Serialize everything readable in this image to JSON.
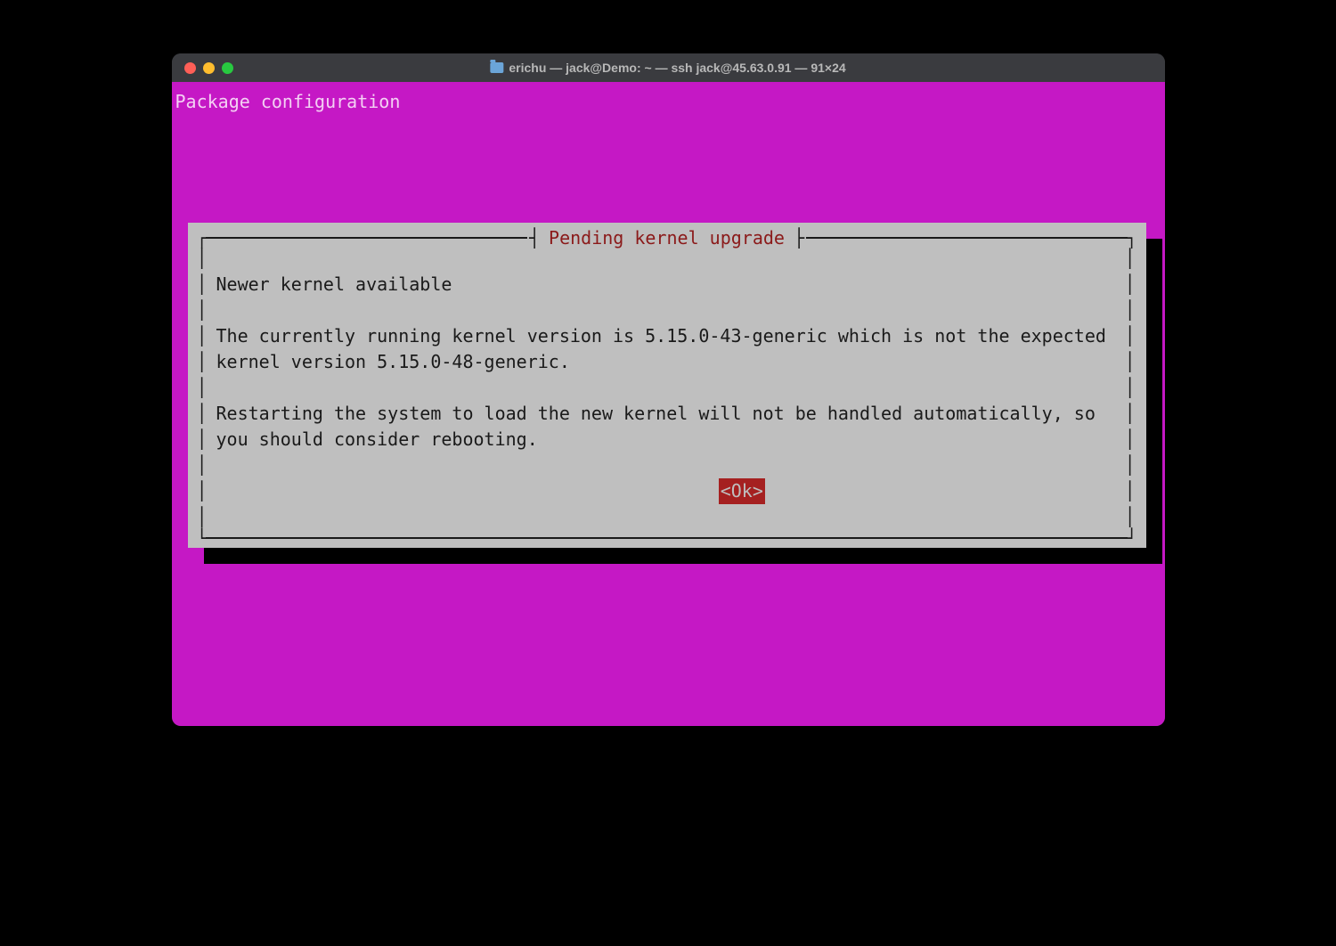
{
  "window": {
    "title": "erichu — jack@Demo: ~ — ssh jack@45.63.0.91 — 91×24"
  },
  "terminal": {
    "header": "Package configuration"
  },
  "dialog": {
    "title": "Pending kernel upgrade",
    "heading": "Newer kernel available",
    "body1": "The currently running kernel version is 5.15.0-43-generic which is not the expected kernel version 5.15.0-48-generic.",
    "body2": "Restarting the system to load the new kernel will not be handled automatically, so you should consider rebooting.",
    "ok_label": "<Ok>"
  }
}
